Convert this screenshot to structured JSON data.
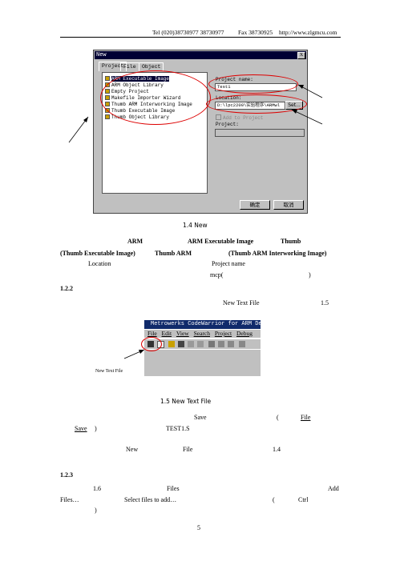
{
  "header": {
    "tel": "Tel  (020)38730977  38730977",
    "fax": "Fax  38730925",
    "url": "http://www.zlgmcu.com"
  },
  "dialog1": {
    "title": "New",
    "close": "X",
    "tabs": [
      "Project",
      "File",
      "Object"
    ],
    "items": [
      "ARM Executable Image",
      "ARM Object Library",
      "Empty Project",
      "Makefile Importer Wizard",
      "Thumb ARM Interworking Image",
      "Thumb Executable Image",
      "Thumb Object Library"
    ],
    "project_name_label": "Project name:",
    "project_name_value": "Test1",
    "location_label": "Location:",
    "location_value": "D:\\lpc2200\\实验程序\\ARMwl",
    "set_button": "Set...",
    "add_to_project": "Add to Project",
    "project_label": "Project:",
    "ok": "确定",
    "cancel": "取消"
  },
  "fig14": "1.4    New",
  "para1": {
    "l1a": "ARM",
    "l1b": "ARM  Executable  Image",
    "l1c": "Thumb",
    "l2a": "(Thumb Executable Image)",
    "l2b": "Thumb  ARM",
    "l2c": "(Thumb ARM Interworking Image)",
    "l3a": "Location",
    "l3b": "Project name",
    "l4a": "mcp(",
    "l4b": ")"
  },
  "sec122": "1.2.2",
  "p2": {
    "a": "New Text File",
    "b": "1.5"
  },
  "codewarrior": {
    "title": "Metrowerks CodeWarrior for ARM Deve",
    "menu": [
      "File",
      "Edit",
      "View",
      "Search",
      "Project",
      "Debug"
    ]
  },
  "new_text_file_label": "New Text File",
  "fig15": "1.5      New Text File",
  "p3": {
    "save": "Save",
    "paren_open": "(",
    "file": "File",
    "save2": "Save",
    "paren_close": ")",
    "test": "TEST1.S"
  },
  "p4": {
    "new": "New",
    "file": "File",
    "fig": "1.4"
  },
  "sec123": "1.2.3",
  "p5": {
    "a": "1.6",
    "b": "Files",
    "c": "Add",
    "d": "Files…",
    "e": "Select files to add…",
    "f": "(",
    "g": "Ctrl",
    "h": ")"
  },
  "page_number": "5"
}
